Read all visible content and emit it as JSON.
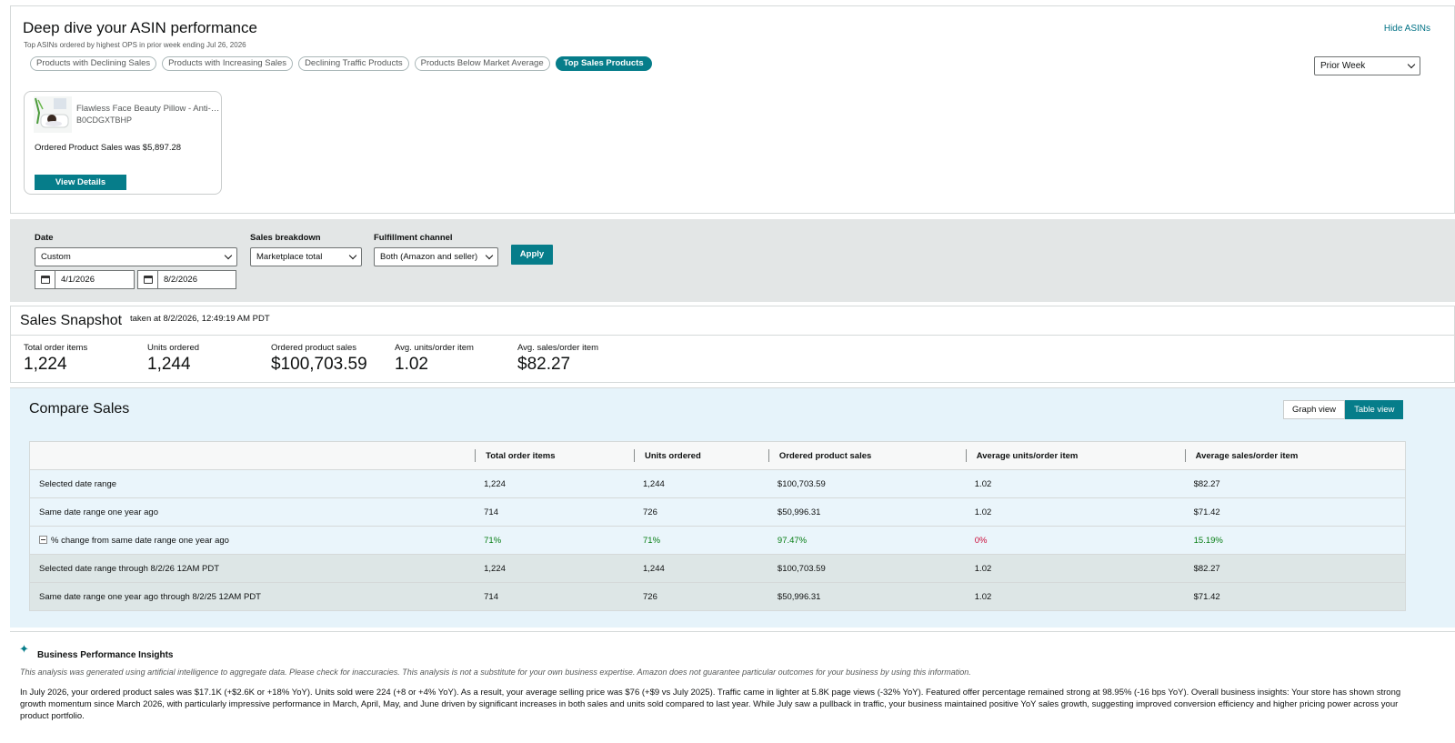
{
  "asin_panel": {
    "title": "Deep dive your ASIN performance",
    "subtitle": "Top ASINs ordered by highest OPS in prior week ending Jul 26, 2026",
    "hide_label": "Hide ASINs",
    "chips": [
      {
        "label": "Products with Declining Sales",
        "active": false
      },
      {
        "label": "Products with Increasing Sales",
        "active": false
      },
      {
        "label": "Declining Traffic Products",
        "active": false
      },
      {
        "label": "Products Below Market Average",
        "active": false
      },
      {
        "label": "Top Sales Products",
        "active": true
      }
    ],
    "period_select": "Prior Week",
    "product": {
      "name": "Flawless Face Beauty Pillow - Anti-…",
      "asin": "B0CDGXTBHP",
      "sales_text": "Ordered Product Sales was $5,897.28",
      "button_label": "View Details"
    }
  },
  "filters": {
    "date_label": "Date",
    "date_select": "Custom",
    "start_date": "4/1/2026",
    "end_date": "8/2/2026",
    "breakdown_label": "Sales breakdown",
    "breakdown_select": "Marketplace total",
    "channel_label": "Fulfillment channel",
    "channel_select": "Both (Amazon and seller)",
    "apply_label": "Apply"
  },
  "snapshot": {
    "title": "Sales Snapshot",
    "taken": "taken at 8/2/2026, 12:49:19 AM PDT",
    "metrics": [
      {
        "label": "Total order items",
        "value": "1,224"
      },
      {
        "label": "Units ordered",
        "value": "1,244"
      },
      {
        "label": "Ordered product sales",
        "value": "$100,703.59"
      },
      {
        "label": "Avg. units/order item",
        "value": "1.02"
      },
      {
        "label": "Avg. sales/order item",
        "value": "$82.27"
      }
    ]
  },
  "compare": {
    "title": "Compare Sales",
    "graph_view": "Graph view",
    "table_view": "Table view",
    "headers": [
      "",
      "Total order items",
      "Units ordered",
      "Ordered product sales",
      "Average units/order item",
      "Average sales/order item"
    ],
    "rows": [
      {
        "cells": [
          "Selected date range",
          "1,224",
          "1,244",
          "$100,703.59",
          "1.02",
          "$82.27"
        ]
      },
      {
        "cells": [
          "Same date range one year ago",
          "714",
          "726",
          "$50,996.31",
          "1.02",
          "$71.42"
        ]
      },
      {
        "cells": [
          "% change from same date range one year ago",
          "71%",
          "71%",
          "97.47%",
          "0%",
          "15.19%"
        ]
      },
      {
        "cells": [
          "Selected date range through 8/2/26 12AM PDT",
          "1,224",
          "1,244",
          "$100,703.59",
          "1.02",
          "$82.27"
        ]
      },
      {
        "cells": [
          "Same date range one year ago through 8/2/25 12AM PDT",
          "714",
          "726",
          "$50,996.31",
          "1.02",
          "$71.42"
        ]
      }
    ],
    "colors": {
      "positive": "#067d13",
      "negative": "#cc0c39",
      "accent": "#067d8a"
    }
  },
  "insights": {
    "title": "Business Performance Insights",
    "disclaimer": "This analysis was generated using artificial intelligence to aggregate data. Please check for inaccuracies. This analysis is not a substitute for your own business expertise. Amazon does not guarantee particular outcomes for your business by using this information.",
    "body": "In July 2026, your ordered product sales was $17.1K (+$2.6K or +18% YoY). Units sold were 224 (+8 or +4% YoY). As a result, your average selling price was $76 (+$9 vs July 2025). Traffic came in lighter at 5.8K page views (-32% YoY). Featured offer percentage remained strong at 98.95% (-16 bps YoY). Overall business insights: Your store has shown strong growth momentum since March 2026, with particularly impressive performance in March, April, May, and June driven by significant increases in both sales and units sold compared to last year. While July saw a pullback in traffic, your business maintained positive YoY sales growth, suggesting improved conversion efficiency and higher pricing power across your product portfolio."
  }
}
